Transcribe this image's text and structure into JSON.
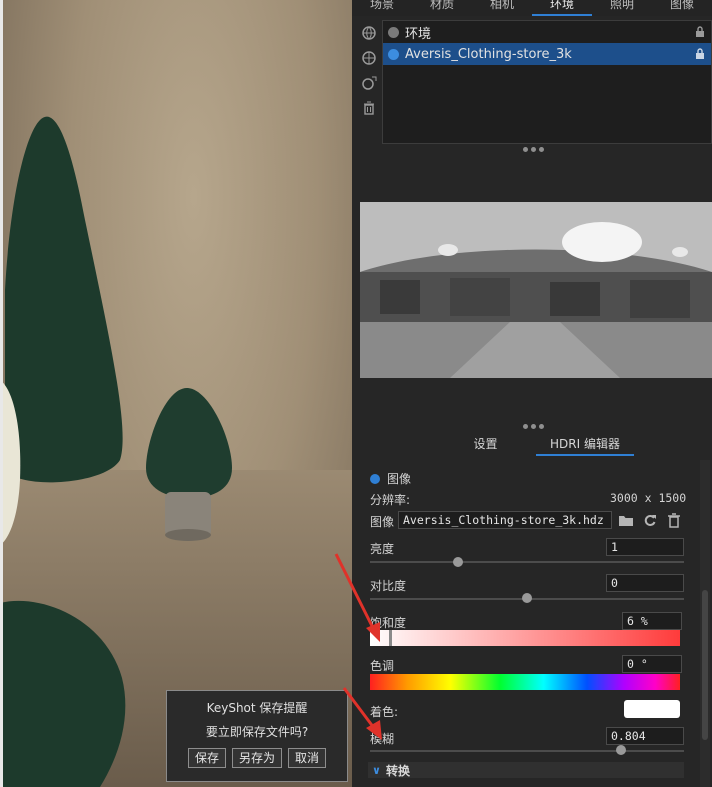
{
  "tabs": [
    {
      "label": "场景",
      "active": false
    },
    {
      "label": "材质",
      "active": false
    },
    {
      "label": "相机",
      "active": false
    },
    {
      "label": "环境",
      "active": true
    },
    {
      "label": "照明",
      "active": false
    },
    {
      "label": "图像",
      "active": false
    }
  ],
  "side_icons": [
    "globe-add-icon",
    "globe-icon",
    "globe-duplicate-icon",
    "trash-icon"
  ],
  "environment_list": [
    {
      "label": "环境",
      "selected": false
    },
    {
      "label": "Aversis_Clothing-store_3k",
      "selected": true
    }
  ],
  "sub_tabs": [
    {
      "label": "设置",
      "active": false
    },
    {
      "label": "HDRI 编辑器",
      "active": true
    }
  ],
  "image_section": {
    "label": "图像",
    "resolution_label": "分辨率:",
    "resolution_value": "3000 x 1500",
    "file_label": "图像",
    "file_value": "Aversis_Clothing-store_3k.hdz"
  },
  "params": {
    "brightness": {
      "label": "亮度",
      "value": "1",
      "slider_fraction": 0.28
    },
    "contrast": {
      "label": "对比度",
      "value": "0",
      "slider_fraction": 0.5
    },
    "saturation": {
      "label": "饱和度",
      "value": "6 %",
      "marker_fraction": 0.06
    },
    "hue": {
      "label": "色调",
      "value": "0 °"
    },
    "tint": {
      "label": "着色:",
      "color": "#ffffff"
    },
    "blur": {
      "label": "模糊",
      "value": "0.804",
      "slider_fraction": 0.8
    }
  },
  "transform_label": "转换",
  "dialog": {
    "title": "KeyShot 保存提醒",
    "message": "要立即保存文件吗?",
    "save_label": "保存",
    "save_as_label": "另存为",
    "cancel_label": "取消"
  },
  "colors": {
    "accent": "#2f7fd4",
    "selected_row": "#1d4f8b",
    "tree_green": "#1d3a2c",
    "annotation_arrow": "#e0322a"
  }
}
